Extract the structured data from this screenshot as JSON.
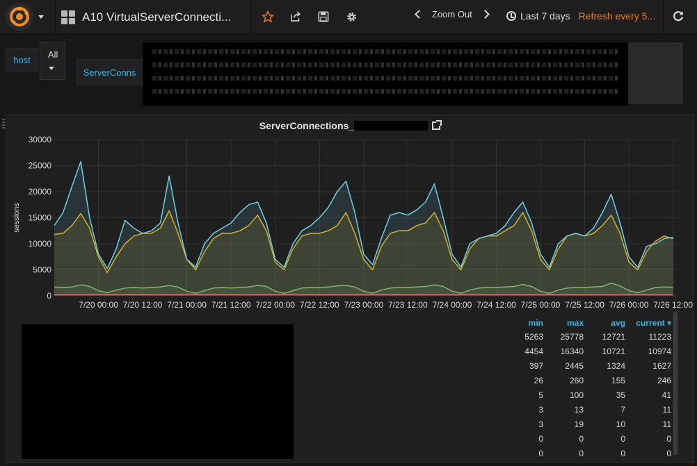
{
  "navbar": {
    "dashboard_title": "A10 VirtualServerConnecti...",
    "zoom_out_label": "Zoom Out",
    "time_range_label": "Last 7 days",
    "refresh_label": "Refresh every 5..."
  },
  "templating": {
    "host_label": "host",
    "host_value": "All",
    "serverconns_label": "ServerConns"
  },
  "panel": {
    "title": "ServerConnections_"
  },
  "chart_data": {
    "type": "line",
    "title": "ServerConnections_",
    "ylabel": "sessions",
    "xlabel": "",
    "ylim": [
      0,
      30000
    ],
    "yticks": [
      0,
      5000,
      10000,
      15000,
      20000,
      25000,
      30000
    ],
    "ytick_labels": [
      "0",
      "5000",
      "10000",
      "15000",
      "20000",
      "25000",
      "30000"
    ],
    "xticks": [
      0.5,
      1.0,
      1.5,
      2.0,
      2.5,
      3.0,
      3.5,
      4.0,
      4.5,
      5.0,
      5.5,
      6.0,
      6.5
    ],
    "xtick_labels": [
      "7/20 00:00",
      "7/20 12:00",
      "7/21 00:00",
      "7/21 12:00",
      "7/22 00:00",
      "7/22 12:00",
      "7/23 00:00",
      "7/23 12:00",
      "7/24 00:00",
      "7/24 12:00",
      "7/25 00:00",
      "7/25 12:00",
      "7/26 00:00",
      "7/26 12:00"
    ],
    "xtick_days": [
      0.5,
      1.0,
      1.5,
      2.0,
      2.5,
      3.0,
      3.5,
      4.0,
      4.5,
      5.0,
      5.5,
      6.0,
      6.5,
      7.0
    ],
    "xlim": [
      0,
      7.05
    ],
    "grid": true,
    "series": [
      {
        "color": "#7eb26d",
        "fill": true,
        "x": [
          0,
          0.1,
          0.2,
          0.3,
          0.4,
          0.5,
          0.6,
          0.7,
          0.8,
          0.9,
          1.0,
          1.1,
          1.2,
          1.3,
          1.4,
          1.5,
          1.6,
          1.7,
          1.8,
          1.9,
          2.0,
          2.1,
          2.2,
          2.3,
          2.4,
          2.5,
          2.6,
          2.7,
          2.8,
          2.9,
          3.0,
          3.1,
          3.2,
          3.3,
          3.4,
          3.5,
          3.6,
          3.7,
          3.8,
          3.9,
          4.0,
          4.1,
          4.2,
          4.3,
          4.4,
          4.5,
          4.6,
          4.7,
          4.8,
          4.9,
          5.0,
          5.1,
          5.2,
          5.3,
          5.4,
          5.5,
          5.6,
          5.7,
          5.8,
          5.9,
          6.0,
          6.1,
          6.2,
          6.3,
          6.4,
          6.5,
          6.6,
          6.7,
          6.8,
          6.9,
          7.0
        ],
        "values": [
          1700,
          1600,
          1700,
          2100,
          1800,
          1000,
          600,
          1100,
          1500,
          1600,
          1500,
          1600,
          1700,
          2000,
          1700,
          900,
          500,
          1000,
          1500,
          1600,
          1500,
          1600,
          1700,
          2000,
          1800,
          900,
          500,
          1000,
          1500,
          1600,
          1600,
          1700,
          1900,
          2000,
          1700,
          900,
          500,
          1100,
          1500,
          1600,
          1600,
          1700,
          1800,
          2100,
          1800,
          900,
          500,
          1100,
          1500,
          1600,
          1600,
          1700,
          1800,
          2200,
          1800,
          900,
          500,
          1100,
          1500,
          1600,
          1600,
          1700,
          1800,
          2445,
          1900,
          1000,
          600,
          1100,
          1600,
          1700,
          1627
        ]
      },
      {
        "color": "#e5ac0e",
        "fill": true,
        "x": [
          0,
          0.1,
          0.2,
          0.3,
          0.4,
          0.5,
          0.6,
          0.7,
          0.8,
          0.9,
          1.0,
          1.1,
          1.2,
          1.3,
          1.4,
          1.5,
          1.6,
          1.7,
          1.8,
          1.9,
          2.0,
          2.1,
          2.2,
          2.3,
          2.4,
          2.5,
          2.6,
          2.7,
          2.8,
          2.9,
          3.0,
          3.1,
          3.2,
          3.3,
          3.4,
          3.5,
          3.6,
          3.7,
          3.8,
          3.9,
          4.0,
          4.1,
          4.2,
          4.3,
          4.4,
          4.5,
          4.6,
          4.7,
          4.8,
          4.9,
          5.0,
          5.1,
          5.2,
          5.3,
          5.4,
          5.5,
          5.6,
          5.7,
          5.8,
          5.9,
          6.0,
          6.1,
          6.2,
          6.3,
          6.4,
          6.5,
          6.6,
          6.7,
          6.8,
          6.9,
          7.0
        ],
        "values": [
          11800,
          12000,
          13500,
          15800,
          13000,
          7500,
          4454,
          7500,
          10000,
          11500,
          12000,
          12000,
          13000,
          16340,
          12000,
          7000,
          5000,
          8500,
          11000,
          12000,
          12000,
          12500,
          13500,
          15500,
          12500,
          6500,
          5000,
          9000,
          11500,
          12000,
          12000,
          12500,
          13500,
          16000,
          12000,
          7000,
          5000,
          9500,
          12000,
          12500,
          12500,
          13500,
          14000,
          16000,
          12500,
          7000,
          5000,
          9000,
          11000,
          11500,
          11500,
          12500,
          13500,
          16000,
          12500,
          7000,
          5000,
          9000,
          11500,
          12000,
          11500,
          12000,
          13500,
          15500,
          12000,
          6500,
          5000,
          8500,
          10500,
          11500,
          10974
        ]
      },
      {
        "color": "#6ed0e0",
        "fill": true,
        "x": [
          0,
          0.1,
          0.2,
          0.3,
          0.4,
          0.5,
          0.6,
          0.7,
          0.8,
          0.9,
          1.0,
          1.1,
          1.2,
          1.3,
          1.4,
          1.5,
          1.6,
          1.7,
          1.8,
          1.9,
          2.0,
          2.1,
          2.2,
          2.3,
          2.4,
          2.5,
          2.6,
          2.7,
          2.8,
          2.9,
          3.0,
          3.1,
          3.2,
          3.3,
          3.4,
          3.5,
          3.6,
          3.7,
          3.8,
          3.9,
          4.0,
          4.1,
          4.2,
          4.3,
          4.4,
          4.5,
          4.6,
          4.7,
          4.8,
          4.9,
          5.0,
          5.1,
          5.2,
          5.3,
          5.4,
          5.5,
          5.6,
          5.7,
          5.8,
          5.9,
          6.0,
          6.1,
          6.2,
          6.3,
          6.4,
          6.5,
          6.6,
          6.7,
          6.8,
          6.9,
          7.0
        ],
        "values": [
          13500,
          16000,
          21000,
          25778,
          15000,
          8000,
          5263,
          9000,
          14500,
          13000,
          12000,
          12500,
          14000,
          23000,
          14000,
          7000,
          5500,
          10000,
          12000,
          13000,
          14000,
          16000,
          17500,
          18000,
          14000,
          7000,
          5500,
          10000,
          12500,
          13500,
          15000,
          17000,
          20000,
          22000,
          16000,
          8000,
          6000,
          11000,
          15500,
          16000,
          15500,
          16500,
          18000,
          21500,
          15000,
          8000,
          5500,
          10000,
          11000,
          11500,
          12000,
          13500,
          16000,
          18000,
          14000,
          8000,
          5500,
          10000,
          11500,
          12000,
          11500,
          13000,
          16000,
          19500,
          14000,
          7500,
          5500,
          9500,
          10000,
          11000,
          11223
        ]
      },
      {
        "color": "#ea6460",
        "fill": false,
        "x": [
          0,
          7.0
        ],
        "values": [
          246,
          246
        ]
      }
    ]
  },
  "legend": {
    "headers": [
      "min",
      "max",
      "avg",
      "current ▾"
    ],
    "rows": [
      {
        "color": "#6ed0e0",
        "min": "5263",
        "max": "25778",
        "avg": "12721",
        "current": "11223"
      },
      {
        "color": "#e5ac0e",
        "min": "4454",
        "max": "16340",
        "avg": "10721",
        "current": "10974"
      },
      {
        "color": "#7eb26d",
        "min": "397",
        "max": "2445",
        "avg": "1324",
        "current": "1627"
      },
      {
        "color": "#e24d42",
        "min": "26",
        "max": "260",
        "avg": "155",
        "current": "246"
      },
      {
        "color": "#ef843c",
        "min": "5",
        "max": "100",
        "avg": "35",
        "current": "41"
      },
      {
        "color": "#ba43a9",
        "min": "3",
        "max": "13",
        "avg": "7",
        "current": "11"
      },
      {
        "color": "#1f78c1",
        "min": "3",
        "max": "19",
        "avg": "10",
        "current": "11"
      },
      {
        "color": "#508642",
        "min": "0",
        "max": "0",
        "avg": "0",
        "current": "0"
      },
      {
        "color": "#705da0",
        "min": "0",
        "max": "0",
        "avg": "0",
        "current": "0"
      }
    ]
  },
  "icons": {
    "logo": "grafana-logo-icon",
    "star": "star-icon",
    "share": "share-icon",
    "save": "save-icon",
    "settings": "gear-icon",
    "refresh": "refresh-icon"
  },
  "colors": {
    "accent_orange": "#eb7b18",
    "link_blue": "#33b5e5"
  }
}
